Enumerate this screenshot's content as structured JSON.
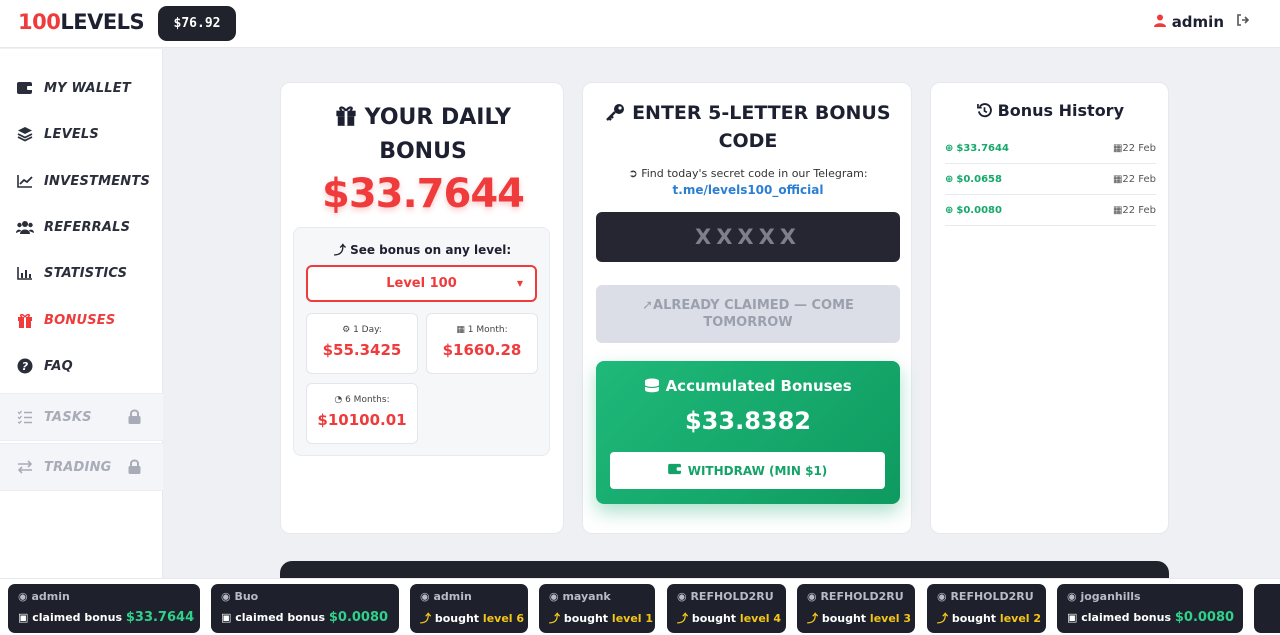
{
  "header": {
    "logo_num": "100",
    "logo_text": "LEVELS",
    "balance": "$76.92",
    "username": "admin"
  },
  "sidebar": {
    "items": [
      {
        "label": "MY WALLET",
        "icon": "wallet-icon"
      },
      {
        "label": "LEVELS",
        "icon": "layers-icon"
      },
      {
        "label": "INVESTMENTS",
        "icon": "chart-line-icon"
      },
      {
        "label": "REFERRALS",
        "icon": "users-icon"
      },
      {
        "label": "STATISTICS",
        "icon": "bar-chart-icon"
      },
      {
        "label": "BONUSES",
        "icon": "gift-icon",
        "active": true
      },
      {
        "label": "FAQ",
        "icon": "question-icon"
      },
      {
        "label": "TASKS",
        "icon": "tasks-icon",
        "locked": true
      },
      {
        "label": "TRADING",
        "icon": "exchange-icon",
        "locked": true
      }
    ]
  },
  "daily": {
    "title_line1": "YOUR DAILY",
    "title_line2": "BONUS",
    "amount": "$33.7644",
    "see_label": "See bonus on any level:",
    "selected_level": "Level 100",
    "proj": [
      {
        "label": "1 Day:",
        "value": "$55.3425"
      },
      {
        "label": "1 Month:",
        "value": "$1660.28"
      },
      {
        "label": "6 Months:",
        "value": "$10100.01"
      }
    ]
  },
  "code": {
    "title_line1": "ENTER 5-LETTER BONUS",
    "title_line2": "CODE",
    "hint": "Find today's secret code in our Telegram:",
    "link": "t.me/levels100_official",
    "placeholder": "XXXXX",
    "claimed_label": "ALREADY CLAIMED — COME TOMORROW",
    "acc_title": "Accumulated Bonuses",
    "acc_amount": "$33.8382",
    "withdraw_label": "WITHDRAW (MIN $1)"
  },
  "history": {
    "title": "Bonus History",
    "rows": [
      {
        "amount": "$33.7644",
        "date": "22 Feb"
      },
      {
        "amount": "$0.0658",
        "date": "22 Feb"
      },
      {
        "amount": "$0.0080",
        "date": "22 Feb"
      }
    ]
  },
  "ticker": [
    {
      "user": "admin",
      "action": "claimed bonus",
      "value": "$33.7644",
      "kind": "bonus"
    },
    {
      "user": "Buo",
      "action": "claimed bonus",
      "value": "$0.0080",
      "kind": "bonus"
    },
    {
      "user": "admin",
      "action": "bought",
      "value": "level 6",
      "kind": "level"
    },
    {
      "user": "mayank",
      "action": "bought",
      "value": "level 1",
      "kind": "level"
    },
    {
      "user": "REFHOLD2RU",
      "action": "bought",
      "value": "level 4",
      "kind": "level"
    },
    {
      "user": "REFHOLD2RU",
      "action": "bought",
      "value": "level 3",
      "kind": "level"
    },
    {
      "user": "REFHOLD2RU",
      "action": "bought",
      "value": "level 2",
      "kind": "level"
    },
    {
      "user": "joganhills",
      "action": "claimed bonus",
      "value": "$0.0080",
      "kind": "bonus"
    }
  ],
  "colors": {
    "accent_red": "#ef3b3b",
    "accent_green": "#15a86a",
    "dark": "#20222c"
  }
}
